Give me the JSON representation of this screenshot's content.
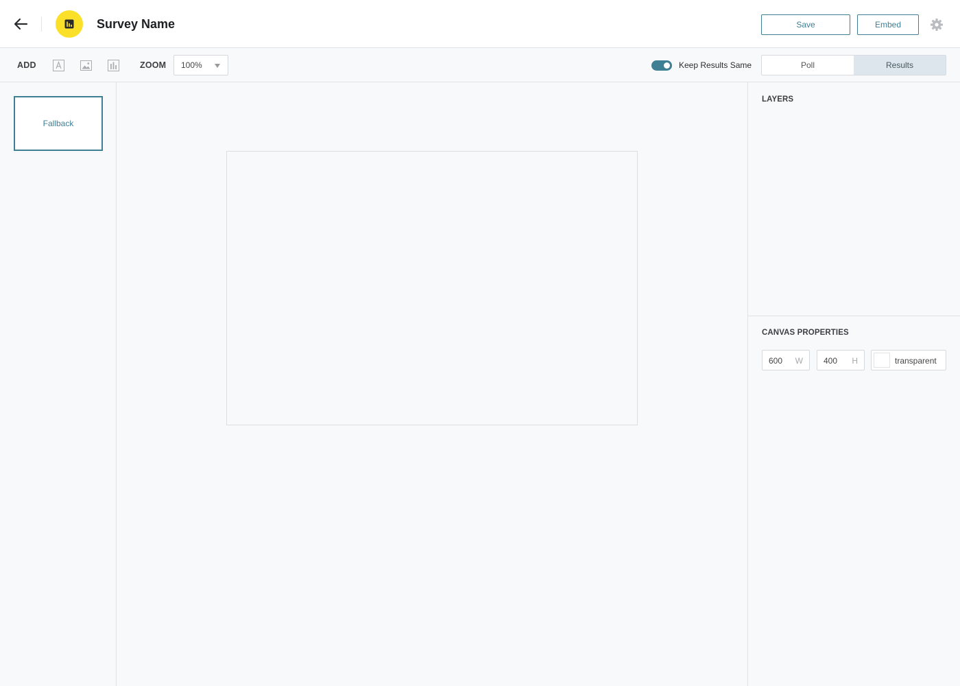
{
  "header": {
    "title": "Survey Name",
    "save_label": "Save",
    "embed_label": "Embed",
    "logo_color": "#fbe02a",
    "accent_color": "#3f7f93"
  },
  "toolbar": {
    "add_label": "ADD",
    "add_icons": [
      "text-icon",
      "image-icon",
      "chart-icon"
    ],
    "zoom_label": "ZOOM",
    "zoom_value": "100%",
    "keep_results_label": "Keep Results Same",
    "keep_results_on": true,
    "view_tabs": [
      {
        "label": "Poll",
        "active": false
      },
      {
        "label": "Results",
        "active": true
      }
    ]
  },
  "slides": [
    {
      "label": "Fallback",
      "selected": true
    }
  ],
  "right_panel": {
    "layers_title": "LAYERS",
    "canvas_properties_title": "CANVAS PROPERTIES",
    "width_value": "600",
    "width_unit": "W",
    "height_value": "400",
    "height_unit": "H",
    "background_value": "transparent"
  }
}
